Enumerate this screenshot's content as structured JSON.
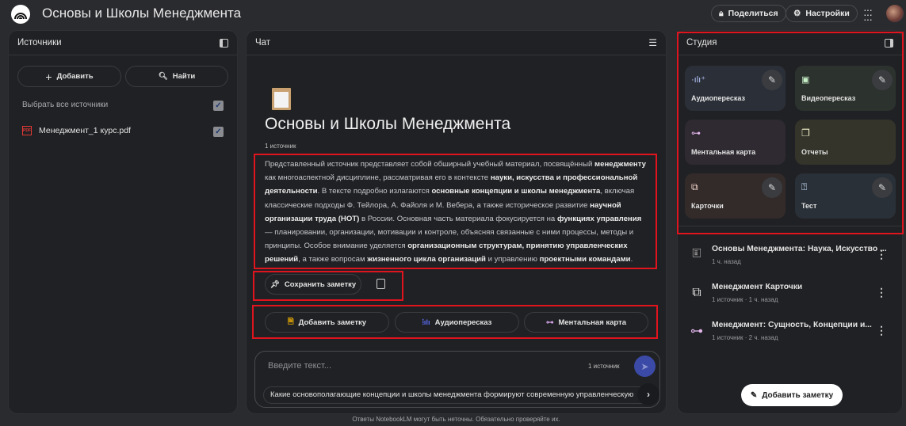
{
  "app": {
    "title": "Основы и Школы Менеджмента",
    "share_label": "Поделиться",
    "settings_label": "Настройки"
  },
  "sources": {
    "title": "Источники",
    "add_label": "Добавить",
    "find_label": "Найти",
    "select_all_label": "Выбрать все источники",
    "items": [
      {
        "name": "Менеджмент_1 курс.pdf",
        "checked": true
      }
    ]
  },
  "chat": {
    "title": "Чат",
    "notebook_title": "Основы и Школы Менеджмента",
    "source_count": "1 источник",
    "summary": [
      {
        "t": "Представленный источник представляет собой обширный учебный материал, посвящённый ",
        "b": false
      },
      {
        "t": "менеджменту",
        "b": true
      },
      {
        "t": " как многоаспектной дисциплине, рассматривая его в контексте ",
        "b": false
      },
      {
        "t": "науки, искусства и профессиональной деятельности",
        "b": true
      },
      {
        "t": ". В тексте подробно излагаются ",
        "b": false
      },
      {
        "t": "основные концепции и школы менеджмента",
        "b": true
      },
      {
        "t": ", включая классические подходы Ф. Тейлора, А. Файоля и М. Вебера, а также историческое развитие ",
        "b": false
      },
      {
        "t": "научной организации труда (НОТ)",
        "b": true
      },
      {
        "t": " в России. Основная часть материала фокусируется на ",
        "b": false
      },
      {
        "t": "функциях управления",
        "b": true
      },
      {
        "t": " — планировании, организации, мотивации и контроле, объясняя связанные с ними процессы, методы и принципы. Особое внимание уделяется ",
        "b": false
      },
      {
        "t": "организационным структурам, принятию управленческих решений",
        "b": true
      },
      {
        "t": ", а также вопросам ",
        "b": false
      },
      {
        "t": "жизненного цикла организаций",
        "b": true
      },
      {
        "t": " и управлению ",
        "b": false
      },
      {
        "t": "проектными командами",
        "b": true
      },
      {
        "t": ".",
        "b": false
      }
    ],
    "save_note_label": "Сохранить заметку",
    "actions": [
      "Добавить заметку",
      "Аудиопересказ",
      "Ментальная карта"
    ],
    "input_placeholder": "Введите текст...",
    "input_source_count": "1 источник",
    "suggestion": "Какие основополагающие концепции и школы менеджмента формируют современную управленческую",
    "disclaimer": "Ответы NotebookLM могут быть неточны. Обязательно проверяйте их."
  },
  "studio": {
    "title": "Студия",
    "cards": [
      {
        "label": "Аудиопересказ",
        "color": "#2b3038"
      },
      {
        "label": "Видеопересказ",
        "color": "#2c322d"
      },
      {
        "label": "Ментальная карта",
        "color": "#2f2a31"
      },
      {
        "label": "Отчеты",
        "color": "#34342a"
      },
      {
        "label": "Карточки",
        "color": "#332b2a"
      },
      {
        "label": "Тест",
        "color": "#2a3037"
      }
    ],
    "items": [
      {
        "title": "Основы Менеджмента: Наука, Искусство ...",
        "sub": "1 ч. назад"
      },
      {
        "title": "Менеджмент Карточки",
        "sub": "1 источник · 1 ч. назад"
      },
      {
        "title": "Менеджмент: Сущность, Концепции и...",
        "sub": "1 источник · 2 ч. назад"
      }
    ],
    "add_note_label": "Добавить заметку"
  }
}
